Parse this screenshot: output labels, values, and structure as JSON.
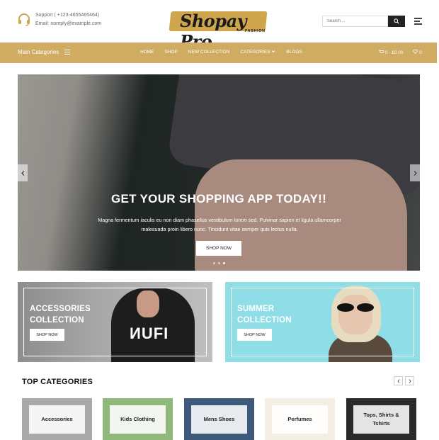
{
  "header": {
    "support_phone": "Support ( +123-4655465464)",
    "support_email": "Email: noreply@example.com",
    "logo_text": "Shopay Pro",
    "logo_sub": "FASHION",
    "search_placeholder": "Search ...",
    "brand_color": "#cfa64e"
  },
  "nav": {
    "main_categories": "Main Categories",
    "links": [
      "HOME",
      "SHOP",
      "NEW COLLECTION",
      "CATEGORIES",
      "BLOGS"
    ],
    "cart": "0 - £0.00",
    "wishlist": "0",
    "bar_color": "#cfac62"
  },
  "hero": {
    "title": "GET YOUR SHOPPING APP TODAY!!",
    "description": "Magna fermentum iaculis eu non diam phasellus vestibulum lorem sed. Pulvinar sapien et ligula ullamcorper malesuada proin libero nunc. Tincidunt vitae semper quis lectus nulla.",
    "button": "SHOP NOW",
    "prev_icon": "chevron-left-icon",
    "next_icon": "chevron-right-icon",
    "slides": 3,
    "active_slide": 3
  },
  "banners": [
    {
      "title_line1": "ACCESSORIES",
      "title_line2": "COLLECTION",
      "button": "SHOP NOW"
    },
    {
      "title_line1": "SUMMER",
      "title_line2": "COLLECTION",
      "button": "SHOP NOW"
    }
  ],
  "top_categories": {
    "title": "TOP CATEGORIES",
    "items": [
      {
        "label": "Accessories",
        "color": "#a9a9a9"
      },
      {
        "label": "Kids Clothing",
        "color": "#8fb87a"
      },
      {
        "label": "Mens Shoes",
        "color": "#3d5a7a"
      },
      {
        "label": "Perfumes",
        "color": "#f4efe3"
      },
      {
        "label": "Tops, Shirts & Tshirts",
        "color": "#2a2a2a"
      }
    ]
  }
}
